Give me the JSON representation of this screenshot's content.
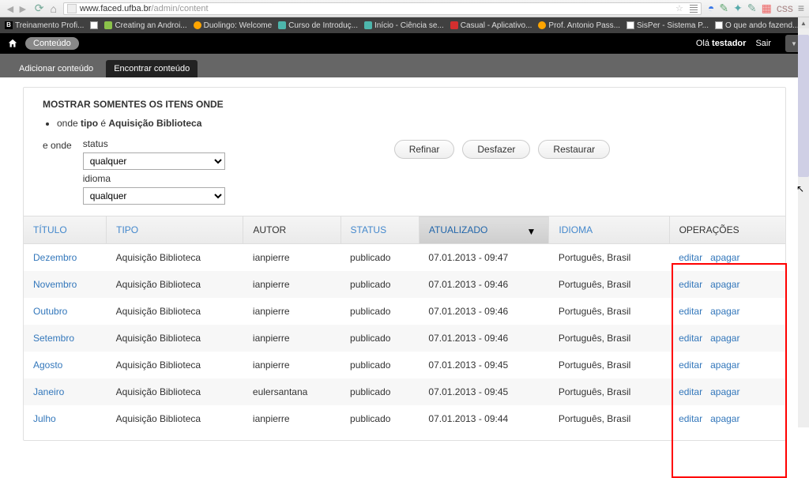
{
  "url": {
    "host": "www.faced.ufba.br",
    "path": "/admin/content"
  },
  "bookmarks": [
    {
      "label": "Treinamento Profi..."
    },
    {
      "label": ""
    },
    {
      "label": "Creating an Androi..."
    },
    {
      "label": "Duolingo: Welcome"
    },
    {
      "label": "Curso de Introduç..."
    },
    {
      "label": "Início - Ciência se..."
    },
    {
      "label": "Casual - Aplicativo..."
    },
    {
      "label": "Prof. Antonio Pass..."
    },
    {
      "label": "SisPer - Sistema P..."
    },
    {
      "label": "O que ando fazend..."
    }
  ],
  "admin": {
    "content": "Conteúdo",
    "greeting_pre": "Olá ",
    "greeting_bold": "testador",
    "logout": "Sair"
  },
  "subnav": {
    "add": "Adicionar conteúdo",
    "find": "Encontrar conteúdo"
  },
  "filters": {
    "heading": "MOSTRAR SOMENTES OS ITENS ONDE",
    "where_pre": "onde ",
    "where_tipo": "tipo",
    "where_mid": " é ",
    "where_value": "Aquisição Biblioteca",
    "and_where": "e onde",
    "status_label": "status",
    "status_value": "qualquer",
    "lang_label": "idioma",
    "lang_value": "qualquer",
    "btn_refine": "Refinar",
    "btn_undo": "Desfazer",
    "btn_reset": "Restaurar"
  },
  "table": {
    "headers": {
      "title": "TÍTULO",
      "type": "TIPO",
      "author": "AUTOR",
      "status": "STATUS",
      "updated": "ATUALIZADO",
      "language": "IDIOMA",
      "operations": "OPERAÇÕES"
    },
    "edit": "editar",
    "delete": "apagar",
    "rows": [
      {
        "title": "Dezembro",
        "type": "Aquisição Biblioteca",
        "author": "ianpierre",
        "status": "publicado",
        "updated": "07.01.2013 - 09:47",
        "lang": "Português, Brasil"
      },
      {
        "title": "Novembro",
        "type": "Aquisição Biblioteca",
        "author": "ianpierre",
        "status": "publicado",
        "updated": "07.01.2013 - 09:46",
        "lang": "Português, Brasil"
      },
      {
        "title": "Outubro",
        "type": "Aquisição Biblioteca",
        "author": "ianpierre",
        "status": "publicado",
        "updated": "07.01.2013 - 09:46",
        "lang": "Português, Brasil"
      },
      {
        "title": "Setembro",
        "type": "Aquisição Biblioteca",
        "author": "ianpierre",
        "status": "publicado",
        "updated": "07.01.2013 - 09:46",
        "lang": "Português, Brasil"
      },
      {
        "title": "Agosto",
        "type": "Aquisição Biblioteca",
        "author": "ianpierre",
        "status": "publicado",
        "updated": "07.01.2013 - 09:45",
        "lang": "Português, Brasil"
      },
      {
        "title": "Janeiro",
        "type": "Aquisição Biblioteca",
        "author": "eulersantana",
        "status": "publicado",
        "updated": "07.01.2013 - 09:45",
        "lang": "Português, Brasil"
      },
      {
        "title": "Julho",
        "type": "Aquisição Biblioteca",
        "author": "ianpierre",
        "status": "publicado",
        "updated": "07.01.2013 - 09:44",
        "lang": "Português, Brasil"
      }
    ]
  }
}
